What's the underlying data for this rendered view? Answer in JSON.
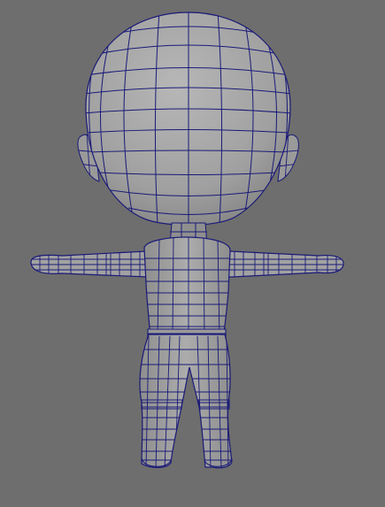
{
  "viewport": {
    "background": "#6e6e6e",
    "mesh_fill": "#a4a4a4",
    "mesh_shadow": "#8a8a8a",
    "wire_color": "#1a1a78",
    "selected_object": "chibi-character-mesh",
    "view_type": "front-view-wireframe-on-shaded"
  }
}
